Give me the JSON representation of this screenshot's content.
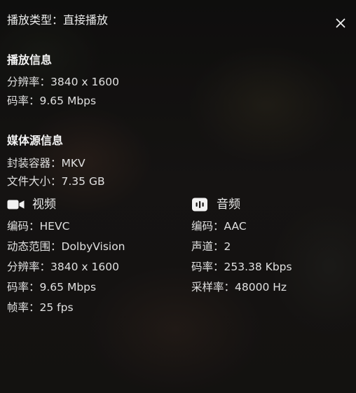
{
  "header": {
    "play_type_label": "播放类型：",
    "play_type_value": "直接播放",
    "close_icon": "close-icon"
  },
  "playback_info": {
    "title": "播放信息",
    "resolution_label": "分辨率：",
    "resolution_value": "3840 x 1600",
    "bitrate_label": "码率：",
    "bitrate_value": "9.65 Mbps"
  },
  "source_info": {
    "title": "媒体源信息",
    "container_label": "封装容器：",
    "container_value": "MKV",
    "filesize_label": "文件大小：",
    "filesize_value": "7.35 GB"
  },
  "video": {
    "title": "视频",
    "icon": "video-camera-icon",
    "codec_label": "编码：",
    "codec_value": "HEVC",
    "dynamic_range_label": "动态范围：",
    "dynamic_range_value": "DolbyVision",
    "resolution_label": "分辨率：",
    "resolution_value": "3840 x 1600",
    "bitrate_label": "码率：",
    "bitrate_value": "9.65 Mbps",
    "framerate_label": "帧率：",
    "framerate_value": "25 fps"
  },
  "audio": {
    "title": "音频",
    "icon": "audio-wave-icon",
    "codec_label": "编码：",
    "codec_value": "AAC",
    "channels_label": "声道：",
    "channels_value": "2",
    "bitrate_label": "码率：",
    "bitrate_value": "253.38 Kbps",
    "samplerate_label": "采样率：",
    "samplerate_value": "48000 Hz"
  },
  "colors": {
    "text": "#e6e6e6",
    "title": "#f2f2f2",
    "background": "#151311"
  }
}
